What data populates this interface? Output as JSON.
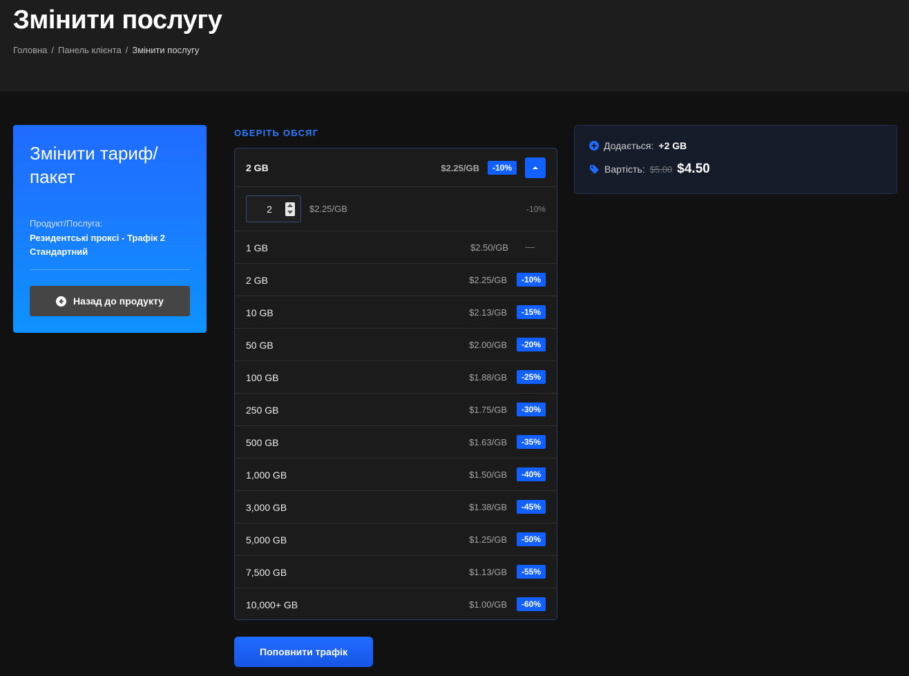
{
  "page": {
    "title": "Змінити послугу",
    "breadcrumb": [
      "Головна",
      "Панель клієнта",
      "Змінити послугу"
    ]
  },
  "left_card": {
    "title": "Змінити тариф/ пакет",
    "product_label": "Продукт/Послуга:",
    "product_name": "Резидентські проксі - Трафік 2 Стандартний",
    "back_button": "Назад до продукту",
    "back_icon": "arrow-left-circle-icon"
  },
  "volume": {
    "section_label": "ОБЕРІТЬ ОБСЯГ",
    "selected": "2 GB",
    "selected_price": "$2.25/GB",
    "selected_discount": "-10%",
    "quantity_value": "2",
    "quantity_unit_price": "$2.25/GB",
    "quantity_discount": "-10%",
    "tiers": [
      {
        "amount": "1 GB",
        "price": "$2.50/GB",
        "discount": "—"
      },
      {
        "amount": "2 GB",
        "price": "$2.25/GB",
        "discount": "-10%"
      },
      {
        "amount": "10 GB",
        "price": "$2.13/GB",
        "discount": "-15%"
      },
      {
        "amount": "50 GB",
        "price": "$2.00/GB",
        "discount": "-20%"
      },
      {
        "amount": "100 GB",
        "price": "$1.88/GB",
        "discount": "-25%"
      },
      {
        "amount": "250 GB",
        "price": "$1.75/GB",
        "discount": "-30%"
      },
      {
        "amount": "500 GB",
        "price": "$1.63/GB",
        "discount": "-35%"
      },
      {
        "amount": "1,000 GB",
        "price": "$1.50/GB",
        "discount": "-40%"
      },
      {
        "amount": "3,000 GB",
        "price": "$1.38/GB",
        "discount": "-45%"
      },
      {
        "amount": "5,000 GB",
        "price": "$1.25/GB",
        "discount": "-50%"
      },
      {
        "amount": "7,500 GB",
        "price": "$1.13/GB",
        "discount": "-55%"
      },
      {
        "amount": "10,000+ GB",
        "price": "$1.00/GB",
        "discount": "-60%"
      }
    ],
    "submit_button": "Поповнити трафік"
  },
  "summary": {
    "added_label": "Додається:",
    "added_value": "+2 GB",
    "cost_label": "Вартість:",
    "old_price": "$5.00",
    "new_price": "$4.50",
    "icons": [
      "plus-circle-icon",
      "tag-icon"
    ]
  },
  "colors": {
    "accent": "#1260ff",
    "background": "#111111",
    "header": "#1d1d1d"
  }
}
